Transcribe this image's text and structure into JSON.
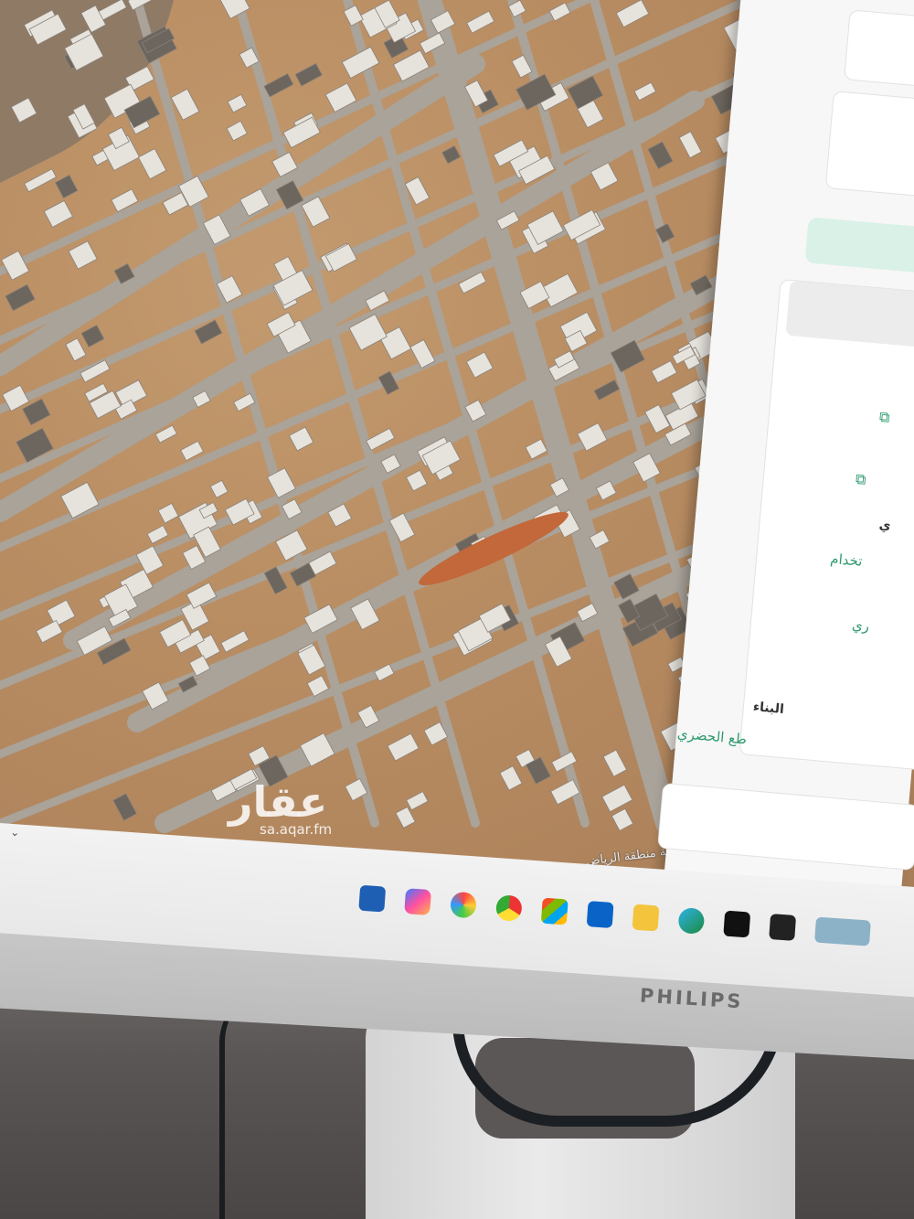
{
  "monitor": {
    "brand": "PHILIPS"
  },
  "watermark": {
    "logo": "عقار",
    "url": "sa.aqar.fm"
  },
  "map": {
    "credit": "جميع الحقوق محفوظة لأمانة منطقة الرياض"
  },
  "panel": {
    "label_1": "ي",
    "value_1": "تخدام",
    "value_2": "ري",
    "label_2": "البناء",
    "value_3": "طع الحضري"
  },
  "colors": {
    "soil": "#b98d62",
    "road": "#a9a39a",
    "building": "#e6e3dd",
    "panel_accent": "#2e9a6e",
    "panel_button": "#d9f1e6"
  },
  "taskbar": {
    "icons": [
      "widgets-icon",
      "copilot-icon",
      "photos-icon",
      "chrome-icon",
      "store-icon",
      "outlook-icon",
      "folder-icon",
      "edge-icon",
      "capcut-icon",
      "app-icon",
      "thumbnail-icon"
    ]
  }
}
